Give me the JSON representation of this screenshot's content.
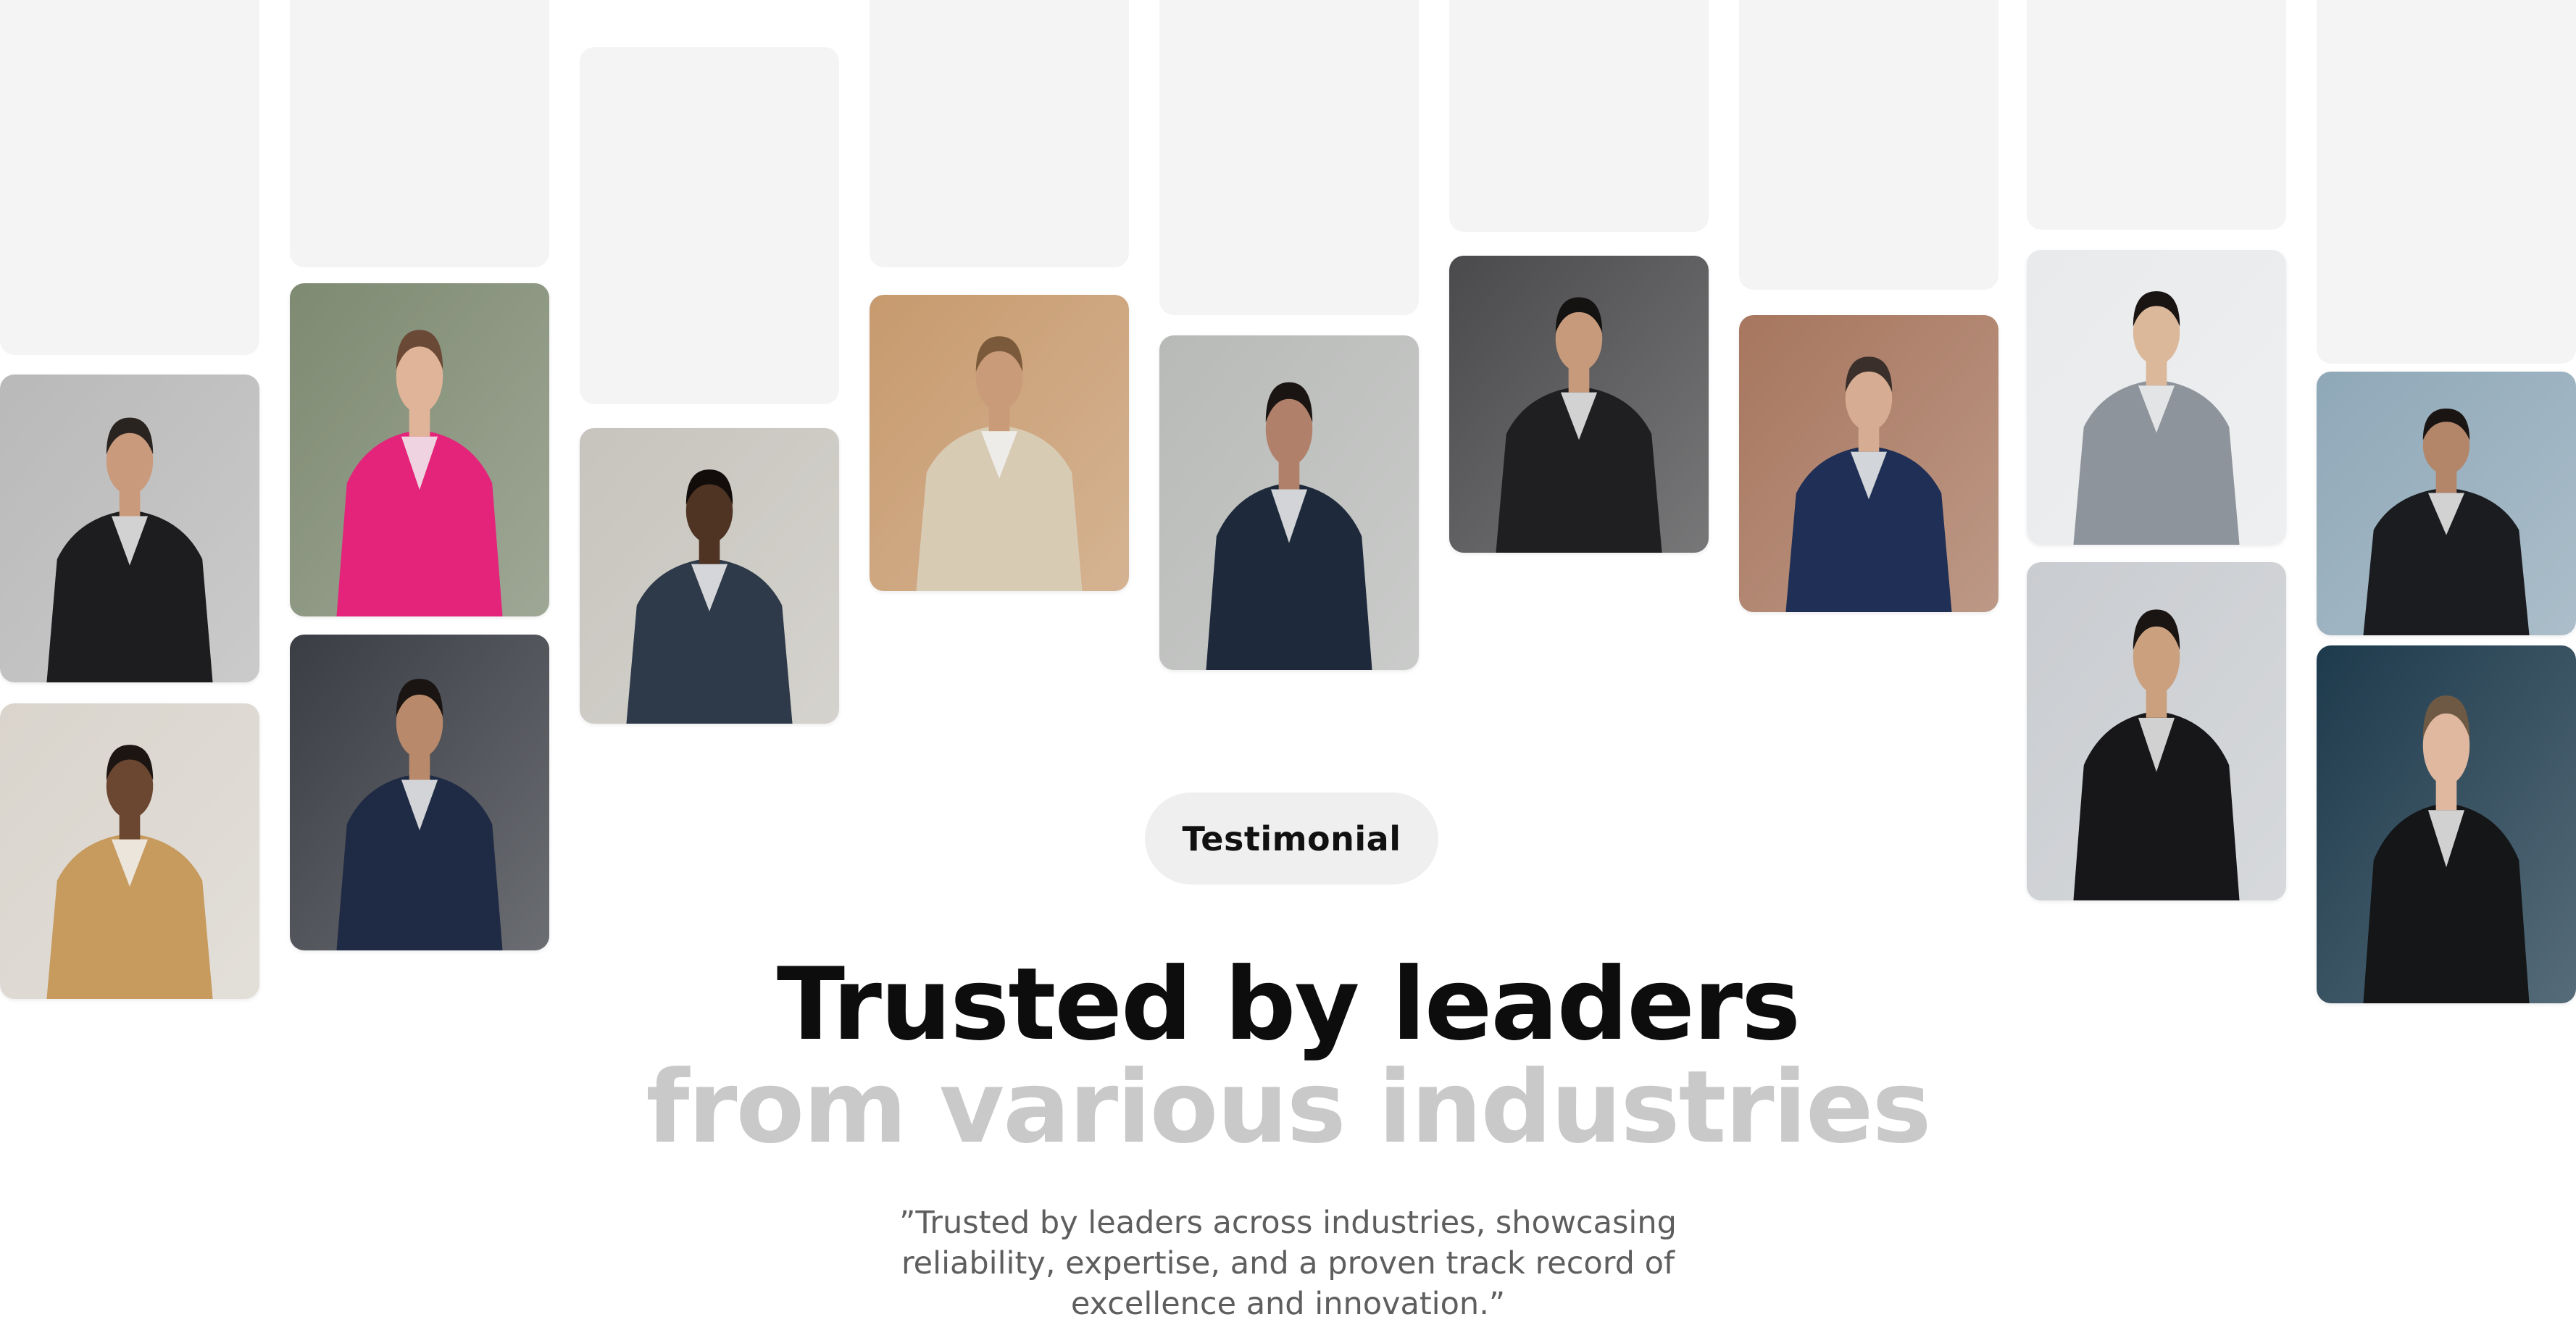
{
  "section": {
    "badge_label": "Testimonial",
    "headline_line1": "Trusted by leaders",
    "headline_line2": "from various industries",
    "quote": "”Trusted by leaders across industries, showcasing reliability, expertise, and a proven track record of excellence and innovation.”"
  },
  "colors": {
    "placeholder": "#f4f4f4",
    "headline_primary": "#0d0d0d",
    "headline_secondary": "#c9c9c9",
    "body_text": "#5e5e5e",
    "badge_bg": "#efefef"
  },
  "photos": [
    {
      "name": "portrait-man-sunglasses-black-suit",
      "bg": "#b9b9b9",
      "suit": "#1d1d1f",
      "skin": "#c99a7c",
      "hair": "#2a2420"
    },
    {
      "name": "portrait-man-phone-camel-coat",
      "bg": "#d9d4cc",
      "suit": "#c79a5e",
      "skin": "#6b4630",
      "hair": "#1c1512"
    },
    {
      "name": "portrait-woman-pink-suit",
      "bg": "#7e8a72",
      "suit": "#e3247a",
      "skin": "#e0b498",
      "hair": "#6a4a36"
    },
    {
      "name": "portrait-man-navy-suit-seated",
      "bg": "#3a3d44",
      "suit": "#1f2a44",
      "skin": "#b8896a",
      "hair": "#1a1512"
    },
    {
      "name": "portrait-man-striped-shirt",
      "bg": "#c7c4bd",
      "suit": "#2e3a4a",
      "skin": "#4f3424",
      "hair": "#120d0a"
    },
    {
      "name": "portrait-woman-beige-blazer",
      "bg": "#c79a6e",
      "suit": "#d8cbb4",
      "skin": "#c99b78",
      "hair": "#7a5a3a"
    },
    {
      "name": "portrait-man-plaid-suit",
      "bg": "#b8bab8",
      "suit": "#1e2a3c",
      "skin": "#b0806a",
      "hair": "#1a1512"
    },
    {
      "name": "portrait-woman-white-blouse",
      "bg": "#4a4a4c",
      "suit": "#1f1f22",
      "skin": "#c89a7c",
      "hair": "#151212"
    },
    {
      "name": "portrait-man-navy-cardigan",
      "bg": "#a7765e",
      "suit": "#1f2f55",
      "skin": "#d6ad92",
      "hair": "#3a2f2a"
    },
    {
      "name": "portrait-man-headset-grey-blazer",
      "bg": "#e8eaec",
      "suit": "#8e949b",
      "skin": "#dcb89a",
      "hair": "#1a1512"
    },
    {
      "name": "portrait-woman-black-suit",
      "bg": "#c9ccd0",
      "suit": "#17171a",
      "skin": "#caa07f",
      "hair": "#1a1512"
    },
    {
      "name": "portrait-man-black-suit-outdoor",
      "bg": "#8fa8b8",
      "suit": "#1b1c20",
      "skin": "#b3866a",
      "hair": "#1a1512"
    },
    {
      "name": "portrait-man-beard-dark-backdrop",
      "bg": "#1d3a4c",
      "suit": "#151618",
      "skin": "#e0b8a0",
      "hair": "#6e5a44"
    }
  ]
}
